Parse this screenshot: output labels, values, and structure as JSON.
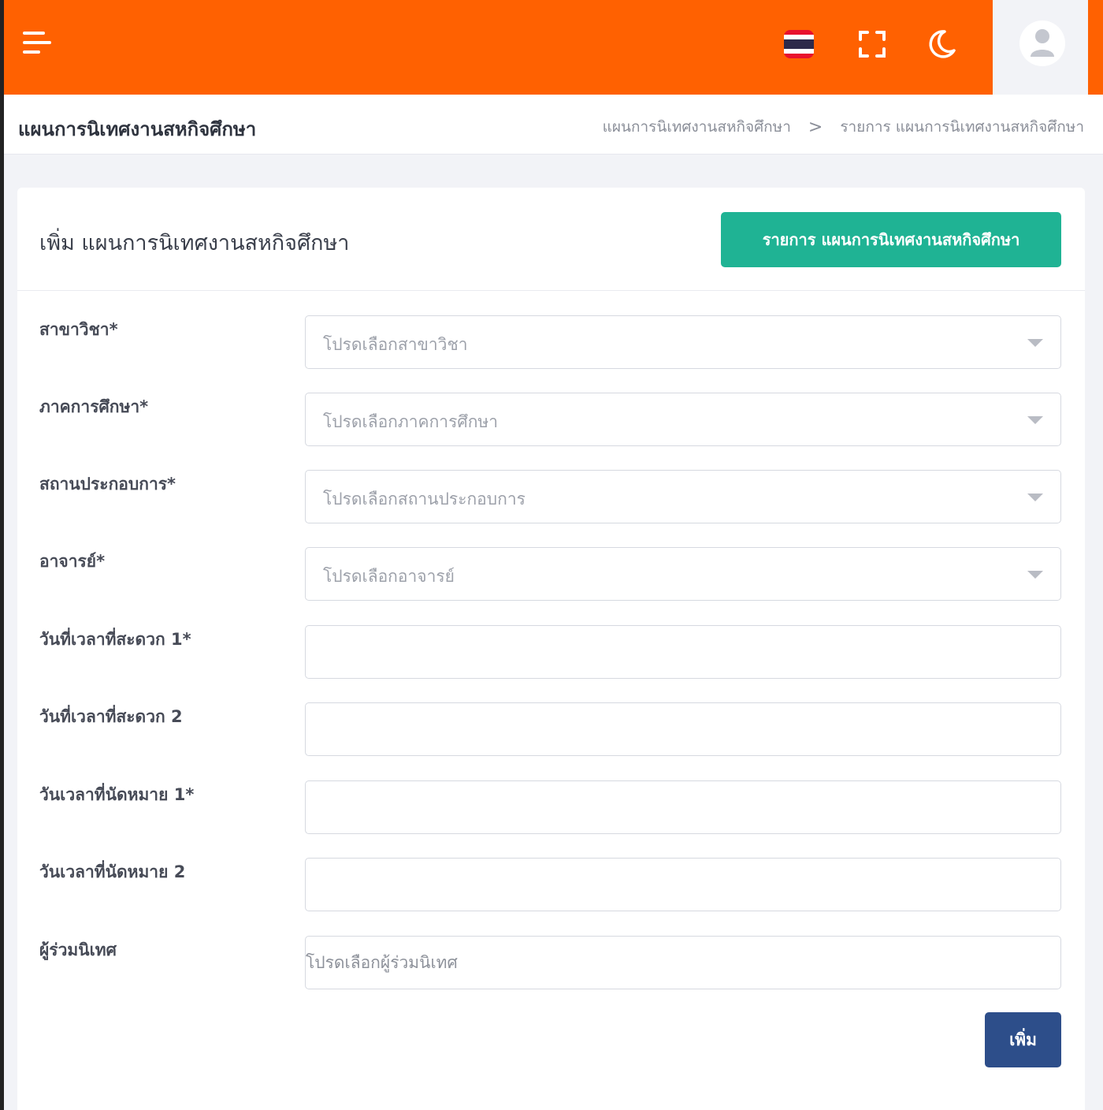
{
  "topbar": {
    "menu_icon": "hamburger-menu-icon",
    "language_icon": "thai-flag-icon",
    "fullscreen_icon": "fullscreen-icon",
    "theme_icon": "moon-icon",
    "user_icon": "user-avatar-icon",
    "brand_color": "#ff6101"
  },
  "header": {
    "title": "แผนการนิเทศงานสหกิจศึกษา",
    "breadcrumb": [
      "แผนการนิเทศงานสหกิจศึกษา",
      "รายการ แผนการนิเทศงานสหกิจศึกษา"
    ],
    "breadcrumb_separator": ">"
  },
  "card": {
    "title": "เพิ่ม แผนการนิเทศงานสหกิจศึกษา",
    "list_button_label": "รายการ แผนการนิเทศงานสหกิจศึกษา",
    "list_button_color": "#1fb394"
  },
  "form": {
    "major": {
      "label": "สาขาวิชา*",
      "placeholder": "โปรดเลือกสาขาวิชา"
    },
    "semester": {
      "label": "ภาคการศึกษา*",
      "placeholder": "โปรดเลือกภาคการศึกษา"
    },
    "company": {
      "label": "สถานประกอบการ*",
      "placeholder": "โปรดเลือกสถานประกอบการ"
    },
    "teacher": {
      "label": "อาจารย์*",
      "placeholder": "โปรดเลือกอาจารย์"
    },
    "convenient_1": {
      "label": "วันที่เวลาที่สะดวก 1*",
      "value": ""
    },
    "convenient_2": {
      "label": "วันที่เวลาที่สะดวก 2",
      "value": ""
    },
    "appointment_1": {
      "label": "วันเวลาที่นัดหมาย 1*",
      "value": ""
    },
    "appointment_2": {
      "label": "วันเวลาที่นัดหมาย 2",
      "value": ""
    },
    "co_supervisor": {
      "label": "ผู้ร่วมนิเทศ",
      "placeholder": "โปรดเลือกผู้ร่วมนิเทศ"
    },
    "submit_label": "เพิ่ม",
    "submit_color": "#2d4e8a"
  }
}
